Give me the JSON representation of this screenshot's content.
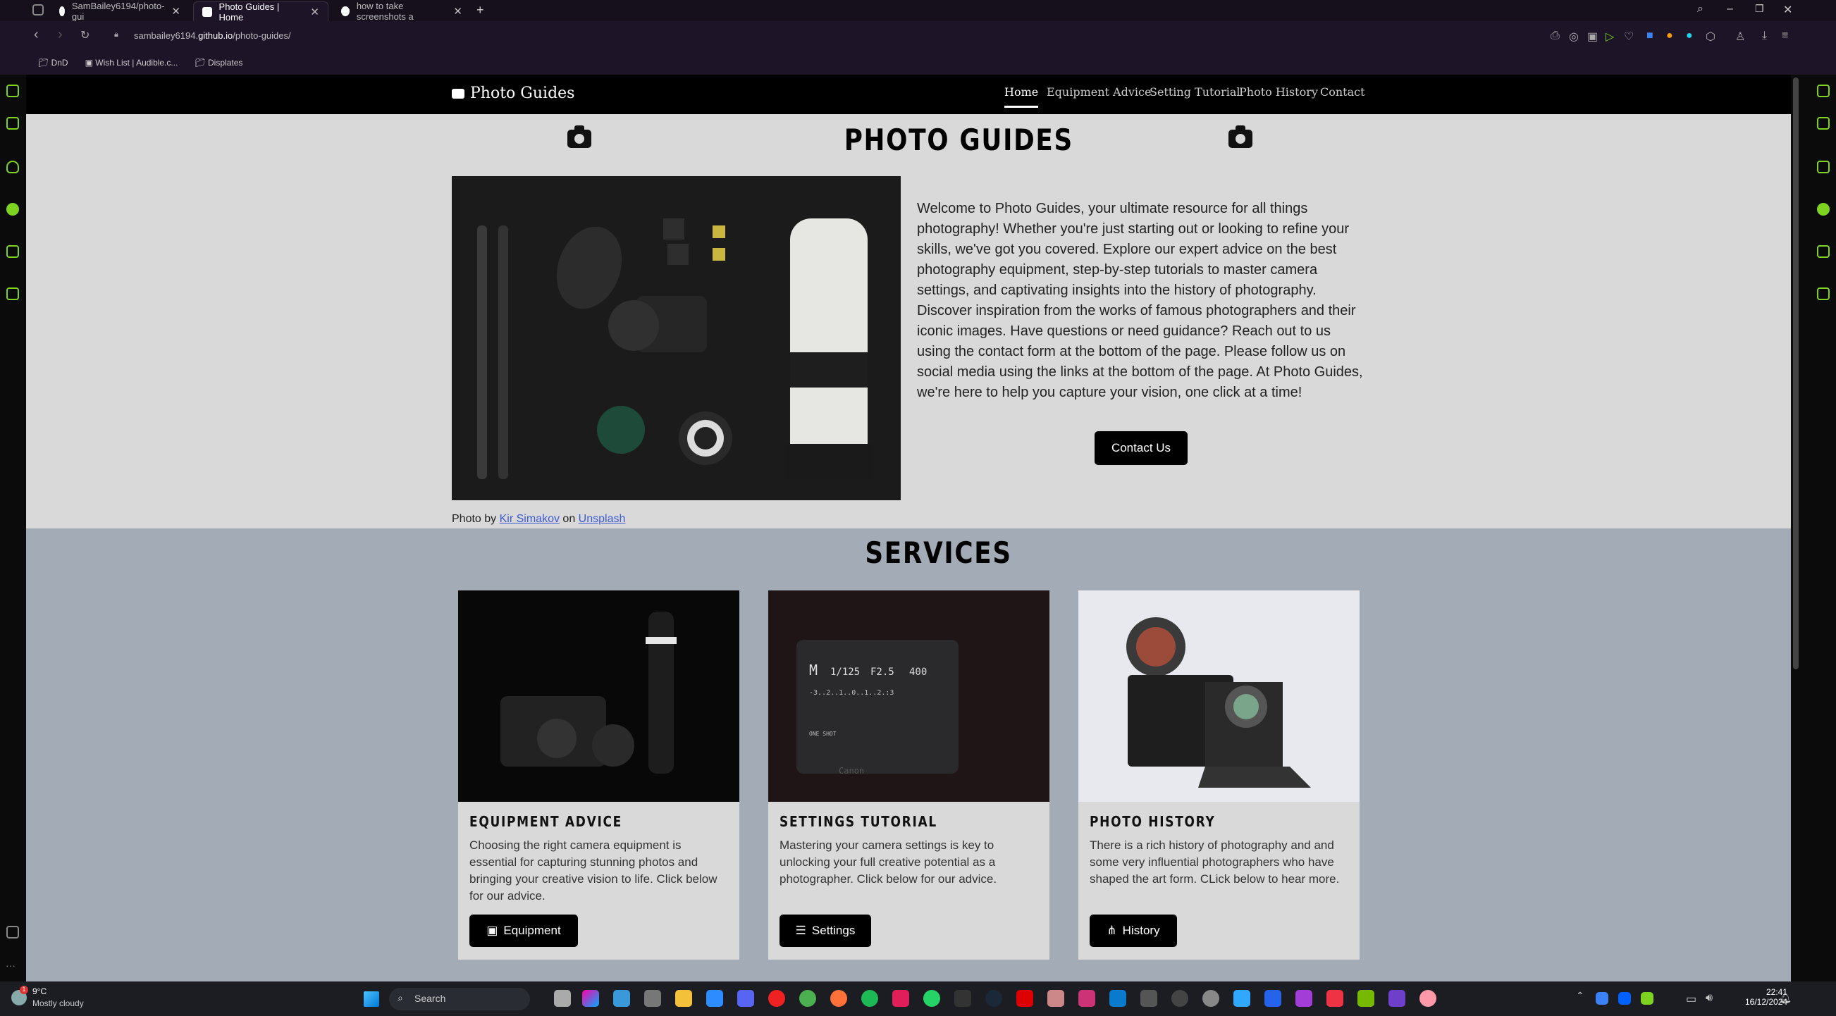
{
  "browser": {
    "tabs": [
      {
        "label": "SamBailey6194/photo-gui"
      },
      {
        "label": "Photo Guides | Home"
      },
      {
        "label": "how to take screenshots a"
      }
    ],
    "new_tab": "+",
    "url_prefix": "sambailey6194.",
    "url_domain": "github.io",
    "url_path": "/photo-guides/",
    "bookmarks": [
      "DnD",
      "Wish List | Audible.c...",
      "Displates"
    ]
  },
  "site": {
    "brand": "Photo Guides",
    "nav": [
      "Home",
      "Equipment Advice",
      "Setting Tutorial",
      "Photo History",
      "Contact"
    ],
    "hero_title": "PHOTO GUIDES",
    "caption_prefix": "Photo by",
    "caption_author": "Kir Simakov",
    "caption_mid": "on",
    "caption_site": "Unsplash",
    "welcome": "Welcome to Photo Guides, your ultimate resource for all things photography! Whether you're just starting out or looking to refine your skills, we've got you covered. Explore our expert advice on the best photography equipment, step-by-step tutorials to master camera settings, and captivating insights into the history of photography. Discover inspiration from the works of famous photographers and their iconic images. Have questions or need guidance? Reach out to us using the contact form at the bottom of the page. Please follow us on social media using the links at the bottom of the page. At Photo Guides, we're here to help you capture your vision, one click at a time!",
    "contact_button": "Contact Us",
    "services_title": "SERVICES",
    "cards": [
      {
        "title": "EQUIPMENT ADVICE",
        "desc": "Choosing the right camera equipment is essential for capturing stunning photos and bringing your creative vision to life. Click below for our advice.",
        "button": "Equipment",
        "icon": "camera-retro-icon"
      },
      {
        "title": "SETTINGS TUTORIAL",
        "desc": "Mastering your camera settings is key to unlocking your full creative potential as a photographer. Click below for our advice.",
        "button": "Settings",
        "icon": "sliders-icon"
      },
      {
        "title": "PHOTO HISTORY",
        "desc": "There is a rich history of photography and and some very influential photographers who have shaped the art form. CLick below to hear more.",
        "button": "History",
        "icon": "timeline-icon"
      }
    ],
    "lcd_text": {
      "mode": "M",
      "shutter": "1/125",
      "aperture": "F2.5",
      "iso": "400",
      "scale": "·3..2..1..0..1..2.:3",
      "brand": "Canon",
      "oneshot": "ONE SHOT"
    }
  },
  "taskbar": {
    "weather_temp": "9°C",
    "weather_desc": "Mostly cloudy",
    "search": "Search",
    "time": "22:41",
    "date": "16/12/2024",
    "badge": "1"
  },
  "colors": {
    "accent_green": "#7ed321",
    "services_bg": "#a3abb6",
    "hero_bg": "#d9d9d9"
  }
}
